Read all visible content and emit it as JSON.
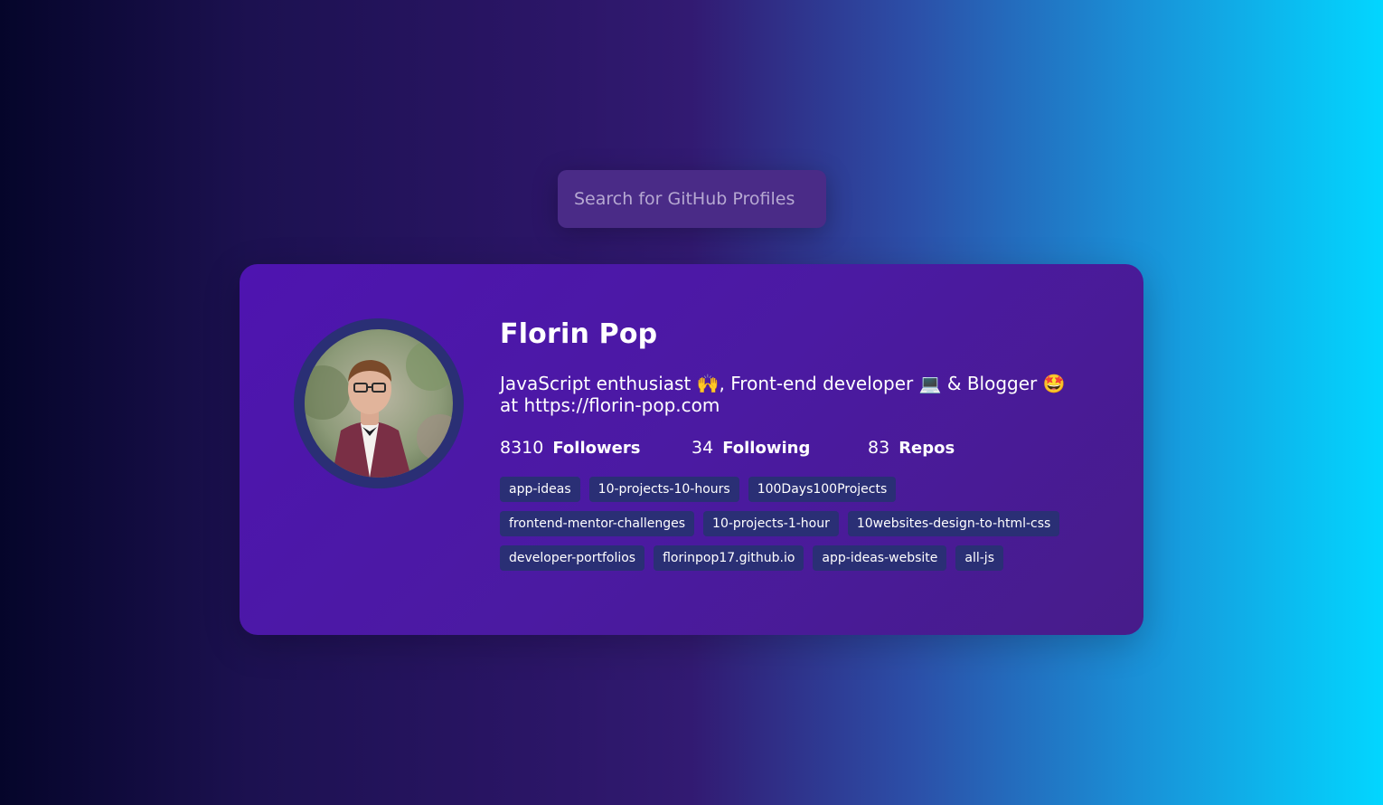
{
  "search": {
    "placeholder": "Search for GitHub Profiles"
  },
  "profile": {
    "name": "Florin Pop",
    "bio": "JavaScript enthusiast 🙌, Front-end developer 💻 & Blogger 🤩 at https://florin-pop.com",
    "stats": {
      "followers": {
        "value": "8310",
        "label": "Followers"
      },
      "following": {
        "value": "34",
        "label": "Following"
      },
      "repos": {
        "value": "83",
        "label": "Repos"
      }
    },
    "repos": [
      "app-ideas",
      "10-projects-10-hours",
      "100Days100Projects",
      "frontend-mentor-challenges",
      "10-projects-1-hour",
      "10websites-design-to-html-css",
      "developer-portfolios",
      "florinpop17.github.io",
      "app-ideas-website",
      "all-js"
    ]
  },
  "colors": {
    "card": "#4e14b0",
    "tag": "#2a2f75",
    "search": "#4a2b87"
  }
}
